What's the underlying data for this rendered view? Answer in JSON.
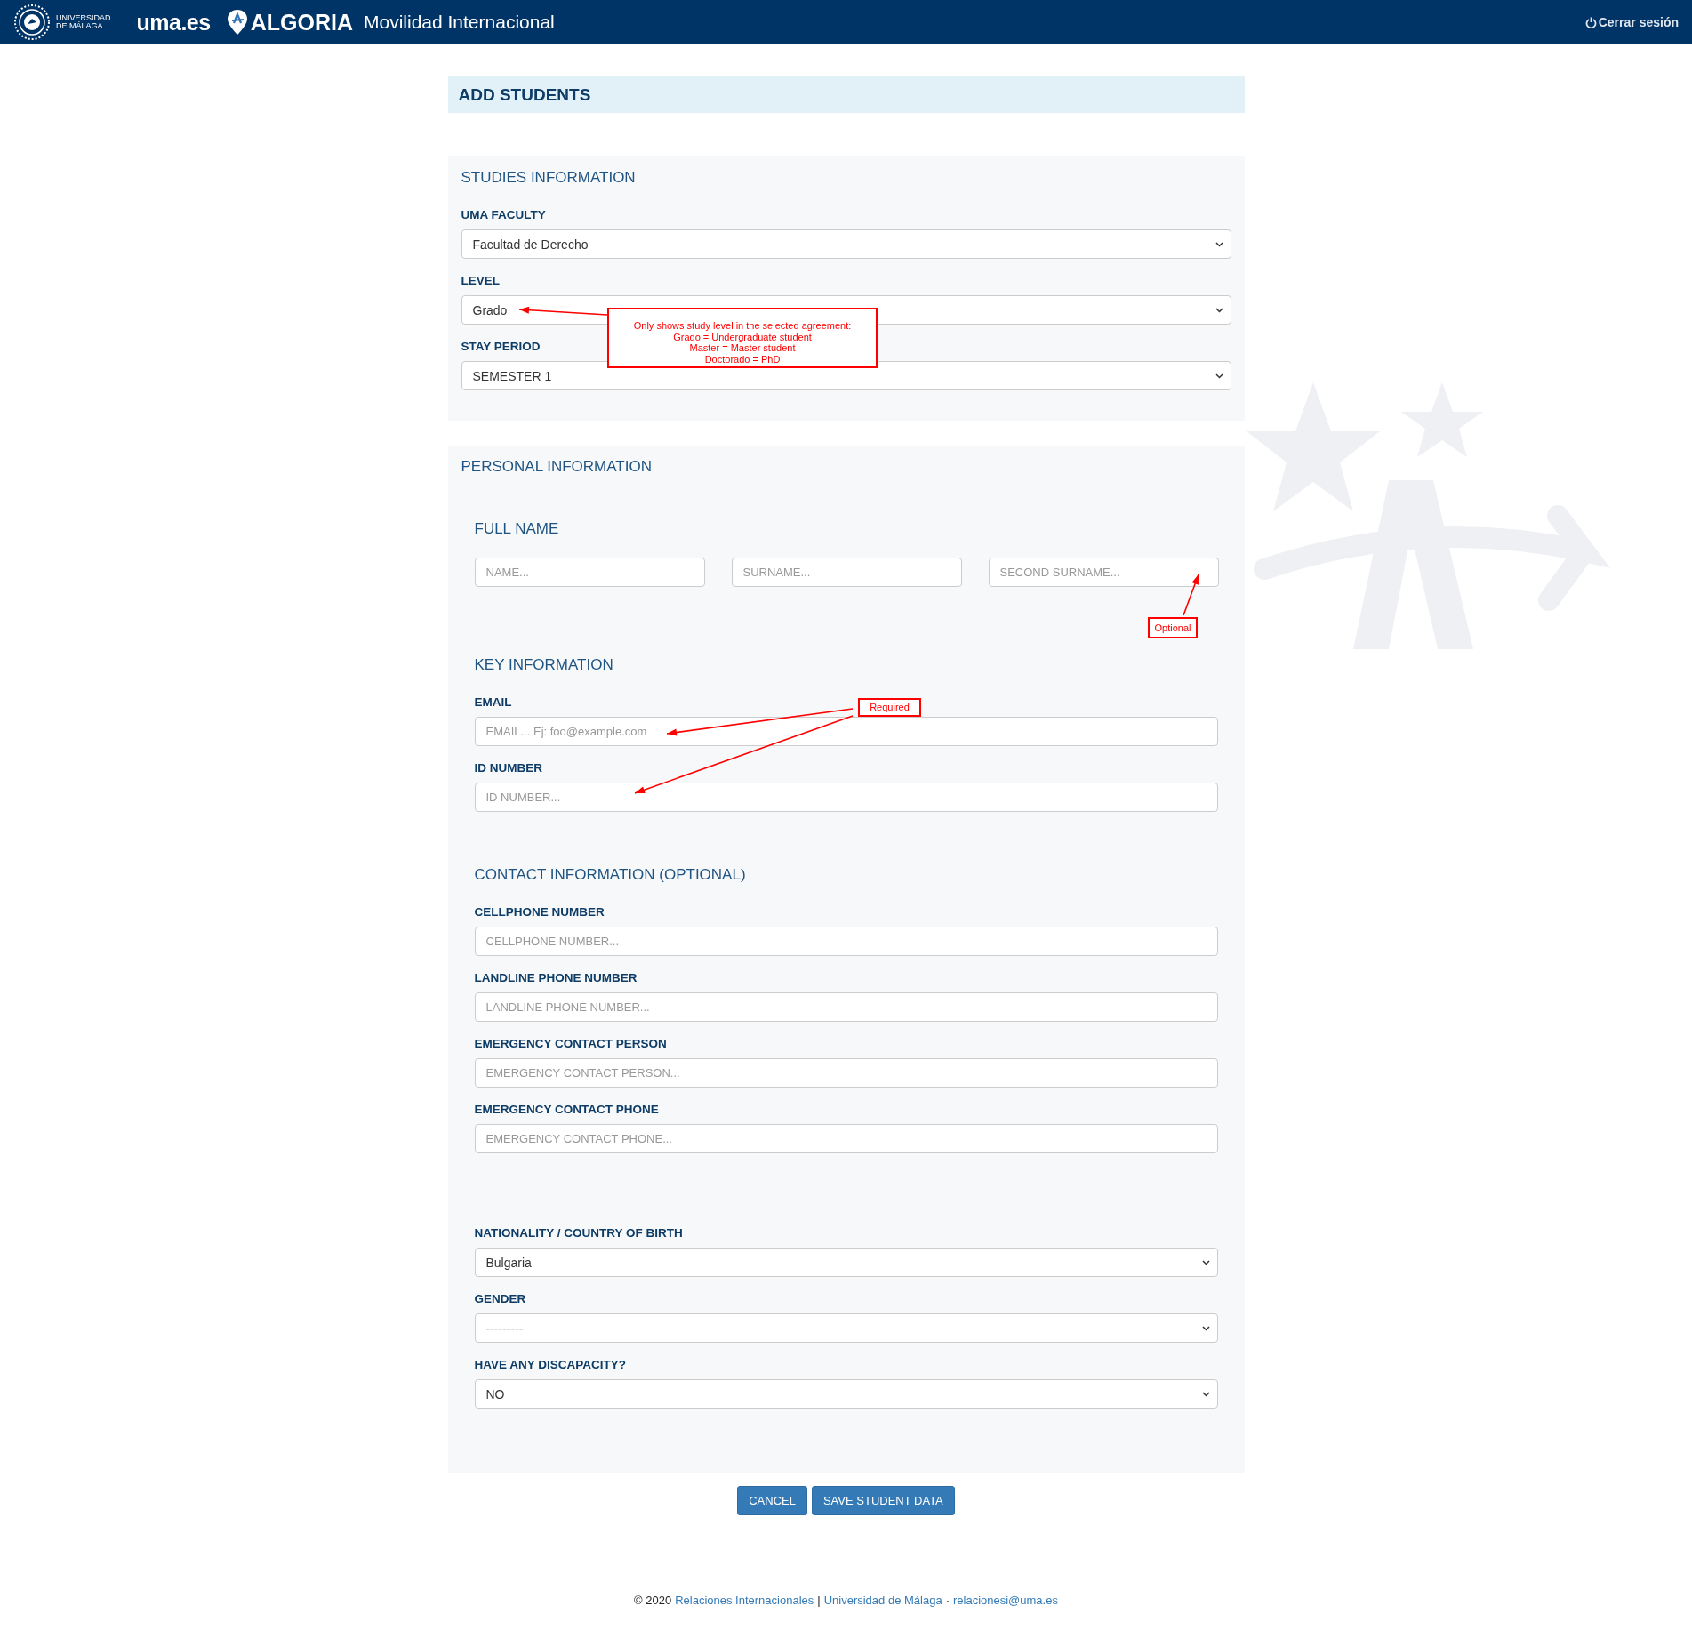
{
  "header": {
    "university": [
      "UNIVERSIDAD",
      "DE MÁLAGA"
    ],
    "site": "uma.es",
    "brand": "ALGORIA",
    "app_title": "Movilidad Internacional",
    "logout": "Cerrar sesión"
  },
  "page_title": "ADD STUDENTS",
  "studies": {
    "title": "STUDIES INFORMATION",
    "fields": [
      {
        "kind": "select",
        "label": "UMA FACULTY",
        "value": "Facultad de Derecho"
      },
      {
        "kind": "select",
        "label": "LEVEL",
        "value": "Grado"
      },
      {
        "kind": "select",
        "label": "STAY PERIOD",
        "value": "SEMESTER 1"
      }
    ]
  },
  "personal": {
    "title": "PERSONAL INFORMATION",
    "groups": [
      {
        "kind": "row",
        "title": "FULL NAME",
        "fields": [
          {
            "kind": "input",
            "placeholder": "NAME..."
          },
          {
            "kind": "input",
            "placeholder": "SURNAME..."
          },
          {
            "kind": "input",
            "placeholder": "SECOND SURNAME..."
          }
        ]
      },
      {
        "kind": "stack",
        "title": "KEY INFORMATION",
        "fields": [
          {
            "kind": "input",
            "label": "EMAIL",
            "placeholder": "EMAIL... Ej: foo@example.com"
          },
          {
            "kind": "input",
            "label": "ID NUMBER",
            "placeholder": "ID NUMBER..."
          }
        ]
      },
      {
        "kind": "stack",
        "title": "CONTACT INFORMATION (OPTIONAL)",
        "fields": [
          {
            "kind": "input",
            "label": "CELLPHONE NUMBER",
            "placeholder": "CELLPHONE NUMBER..."
          },
          {
            "kind": "input",
            "label": "LANDLINE PHONE NUMBER",
            "placeholder": "LANDLINE PHONE NUMBER..."
          },
          {
            "kind": "input",
            "label": "EMERGENCY CONTACT PERSON",
            "placeholder": "EMERGENCY CONTACT PERSON..."
          },
          {
            "kind": "input",
            "label": "EMERGENCY CONTACT PHONE",
            "placeholder": "EMERGENCY CONTACT PHONE..."
          }
        ]
      },
      {
        "kind": "stack",
        "fields": [
          {
            "kind": "select",
            "label": "NATIONALITY / COUNTRY OF BIRTH",
            "value": "Bulgaria"
          },
          {
            "kind": "select",
            "label": "GENDER",
            "value": "---------"
          },
          {
            "kind": "select",
            "label": "HAVE ANY DISCAPACITY?",
            "value": "NO"
          }
        ]
      }
    ]
  },
  "annotations": {
    "level_note": [
      "Only shows study level in the selected agreement:",
      "Grado = Undergraduate student",
      "Master = Master student",
      "Doctorado = PhD"
    ],
    "optional_note": "Optional",
    "required_note": "Required"
  },
  "buttons": [
    {
      "label": "CANCEL"
    },
    {
      "label": "SAVE STUDENT DATA"
    }
  ],
  "footer": [
    {
      "kind": "text",
      "text": "© 2020"
    },
    {
      "kind": "link",
      "text": "Relaciones Internacionales"
    },
    {
      "kind": "text",
      "text": "|"
    },
    {
      "kind": "link",
      "text": "Universidad de Málaga"
    },
    {
      "kind": "text",
      "text": "·"
    },
    {
      "kind": "link",
      "text": "relacionesi@uma.es"
    }
  ]
}
